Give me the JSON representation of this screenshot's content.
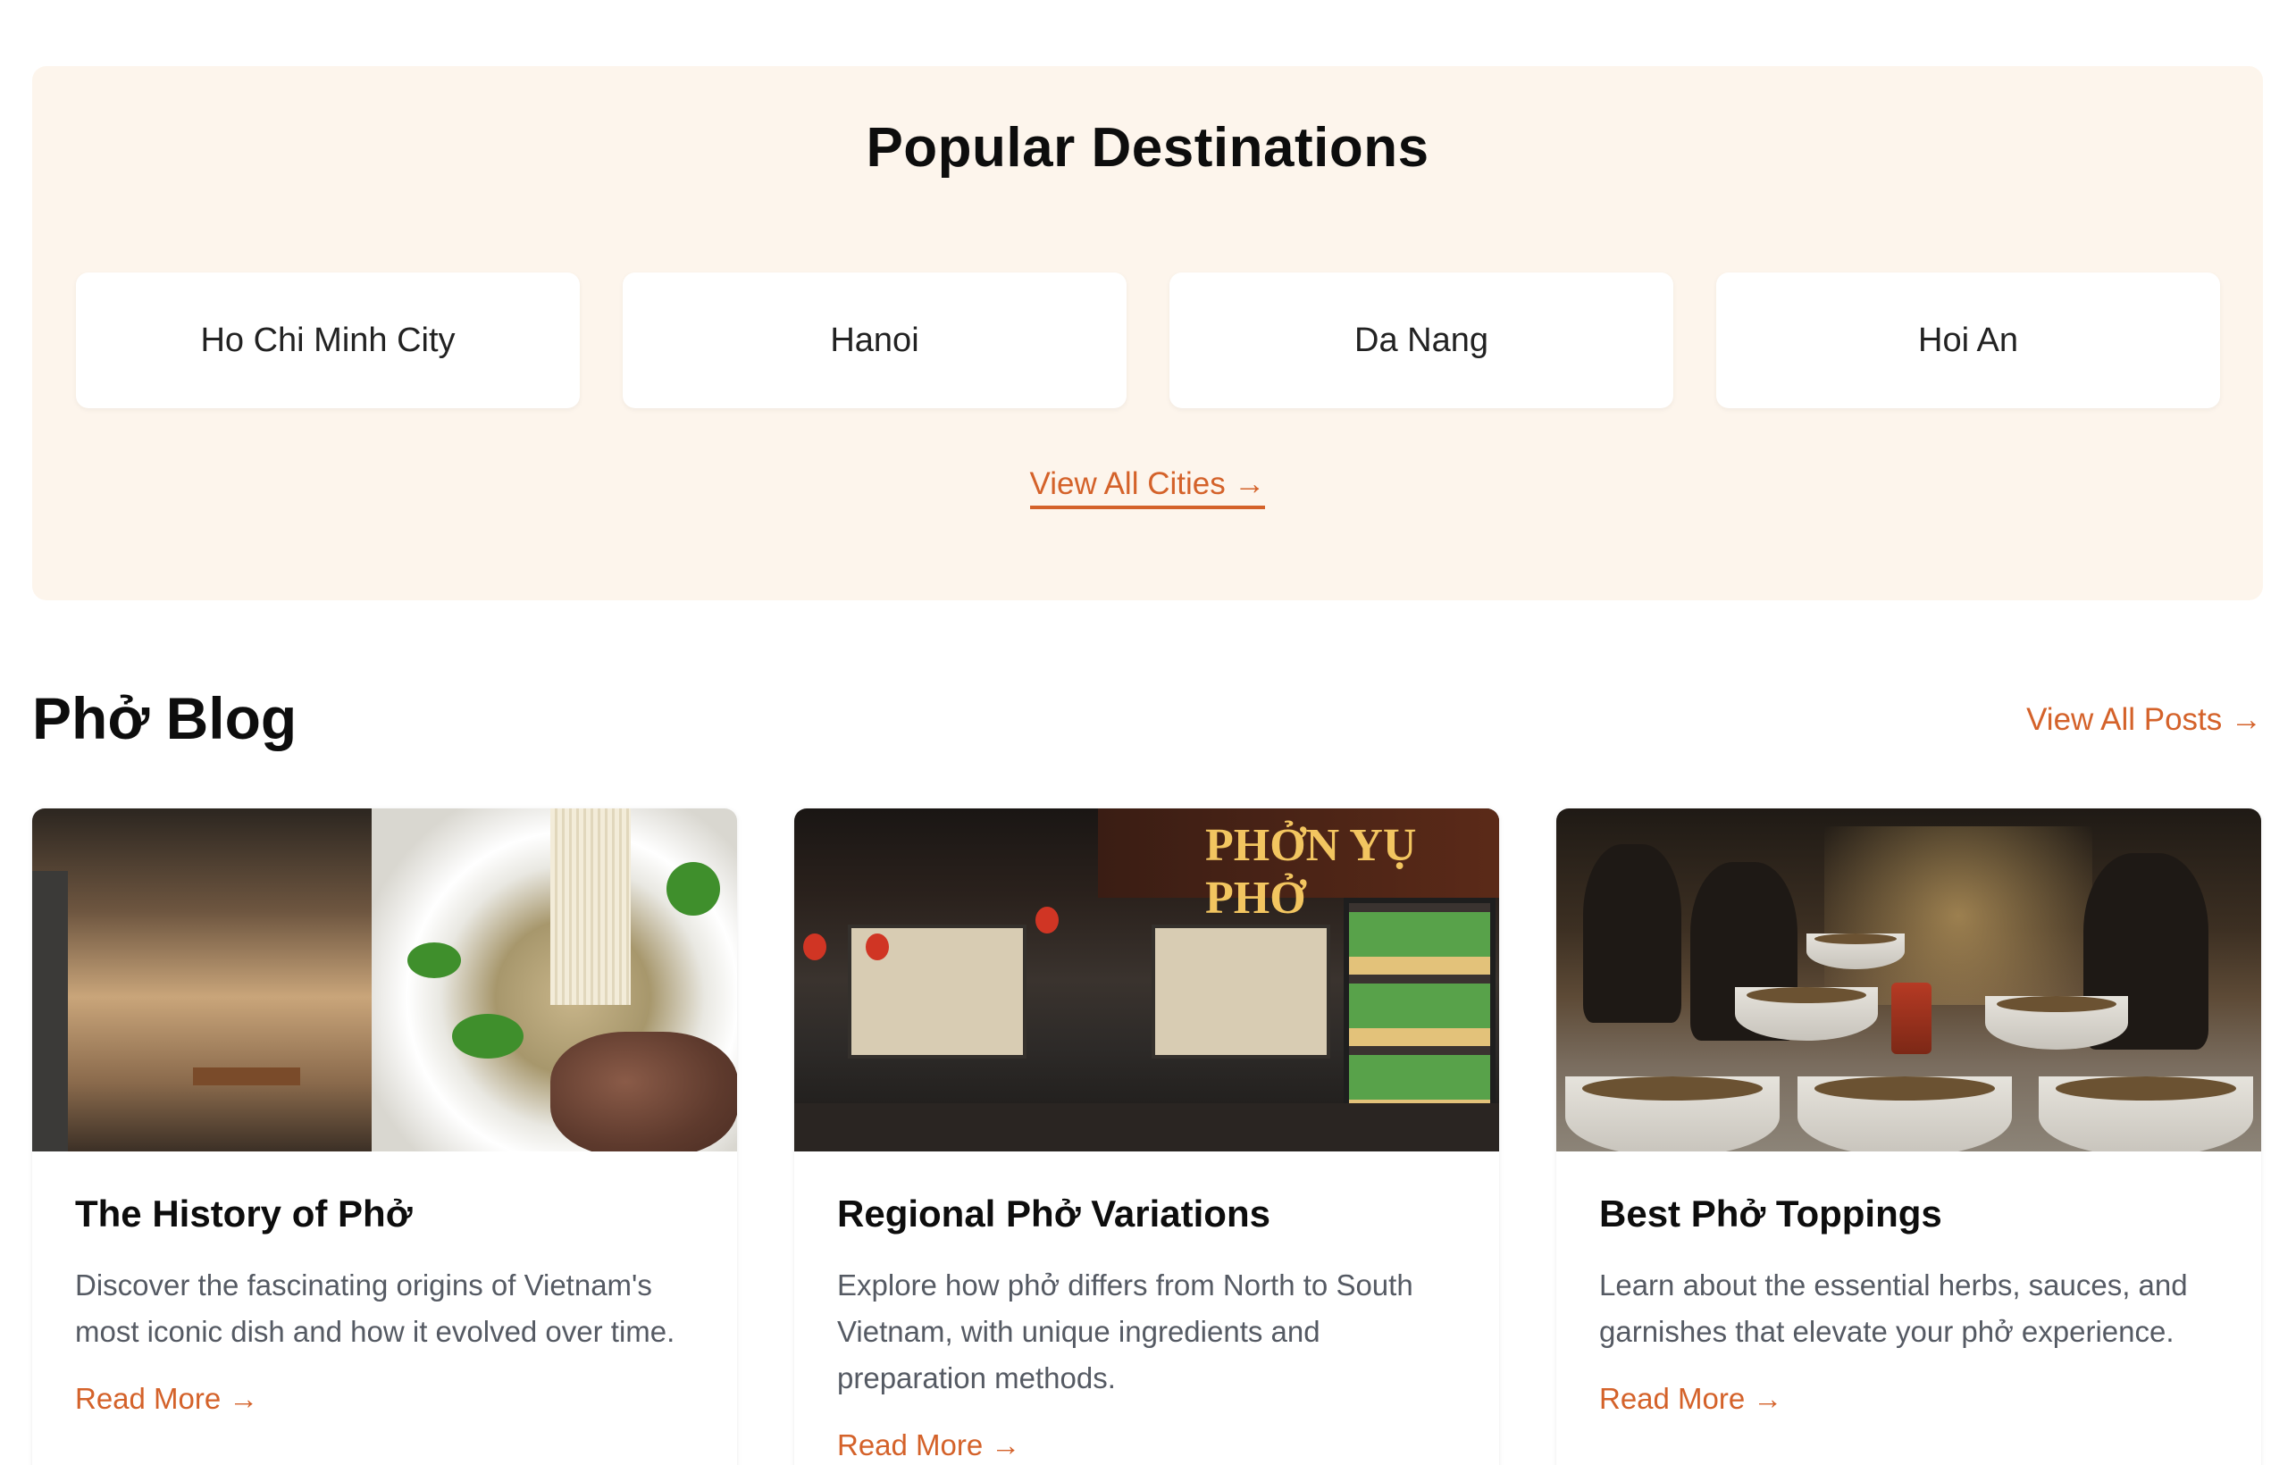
{
  "destinations": {
    "title": "Popular Destinations",
    "cities": [
      {
        "label": "Ho Chi Minh City"
      },
      {
        "label": "Hanoi"
      },
      {
        "label": "Da Nang"
      },
      {
        "label": "Hoi An"
      }
    ],
    "view_all_label": "View All Cities →"
  },
  "blog": {
    "title": "Phở Blog",
    "view_all_label": "View All Posts →",
    "posts": [
      {
        "title": "The History of Phở",
        "excerpt": "Discover the fascinating origins of Vietnam's most iconic dish and how it evolved over time.",
        "read_more": "Read More →",
        "image": "pho-restaurant-and-noodle-bowl-photo"
      },
      {
        "title": "Regional Phở Variations",
        "excerpt": "Explore how phở differs from North to South Vietnam, with unique ingredients and preparation methods.",
        "read_more": "Read More →",
        "image": "night-storefront-photo",
        "sign_text": "PHỞN YỤ PHỞ"
      },
      {
        "title": "Best Phở Toppings",
        "excerpt": "Learn about the essential herbs, sauces, and garnishes that elevate your phở experience.",
        "read_more": "Read More →",
        "image": "table-of-pho-bowls-photo"
      }
    ]
  },
  "colors": {
    "accent": "#d4622a",
    "section_background": "#fdf5ec",
    "text": "#0d0d0d",
    "muted_text": "#555a63"
  }
}
